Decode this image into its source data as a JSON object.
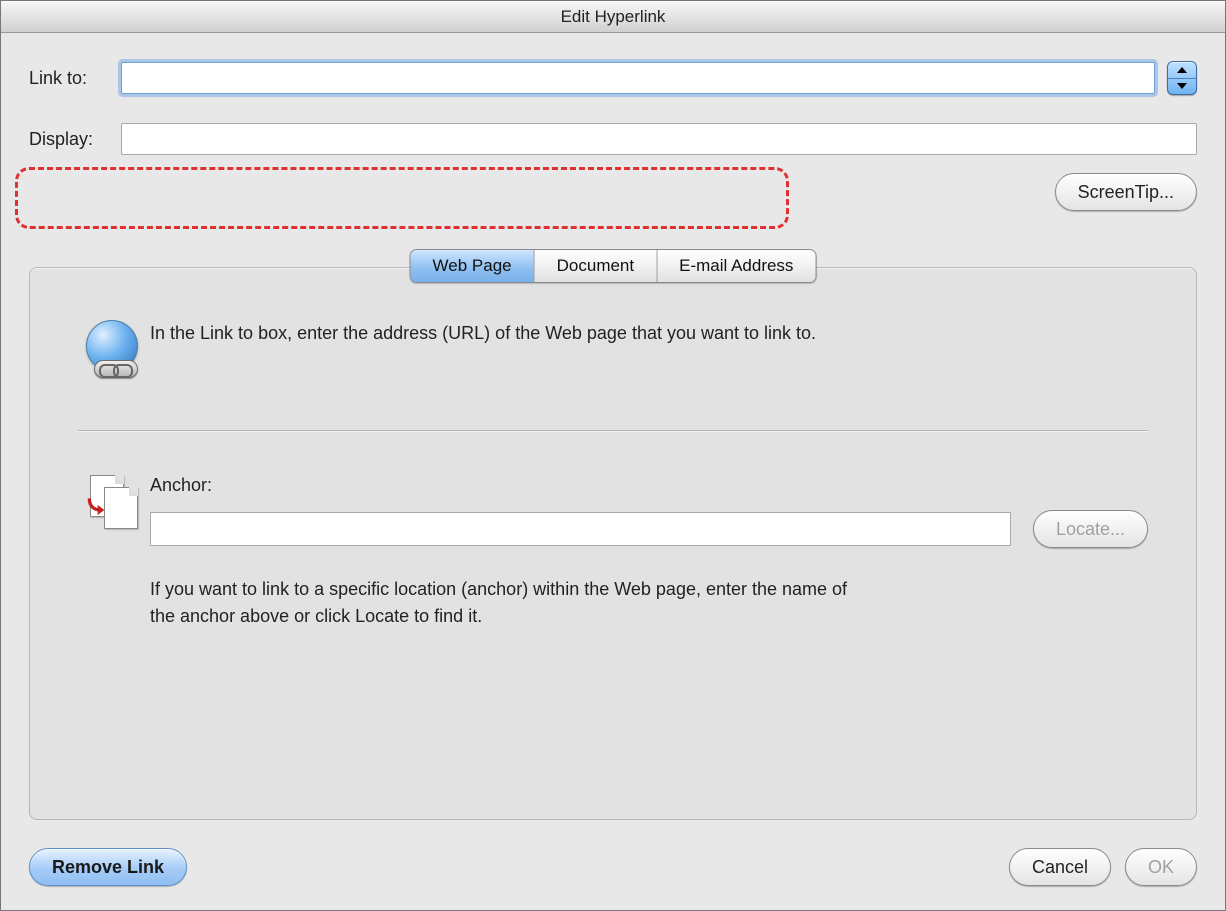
{
  "title": "Edit Hyperlink",
  "labels": {
    "link_to": "Link to:",
    "display": "Display:",
    "anchor": "Anchor:"
  },
  "fields": {
    "link_to_value": "",
    "display_value": "",
    "anchor_value": ""
  },
  "buttons": {
    "screentip": "ScreenTip...",
    "locate": "Locate...",
    "remove_link": "Remove Link",
    "cancel": "Cancel",
    "ok": "OK"
  },
  "tabs": {
    "items": [
      {
        "label": "Web Page",
        "active": true
      },
      {
        "label": "Document",
        "active": false
      },
      {
        "label": "E-mail Address",
        "active": false
      }
    ]
  },
  "help": {
    "url_hint": "In the Link to box, enter the address (URL) of the Web page that you want to link to.",
    "anchor_hint": "If you want to link to a specific location (anchor) within the Web page, enter the name of the anchor above or click Locate to find it."
  },
  "icons": {
    "globe": "globe-link-icon",
    "doc_swap": "document-swap-icon",
    "stepper": "history-stepper-icon"
  }
}
